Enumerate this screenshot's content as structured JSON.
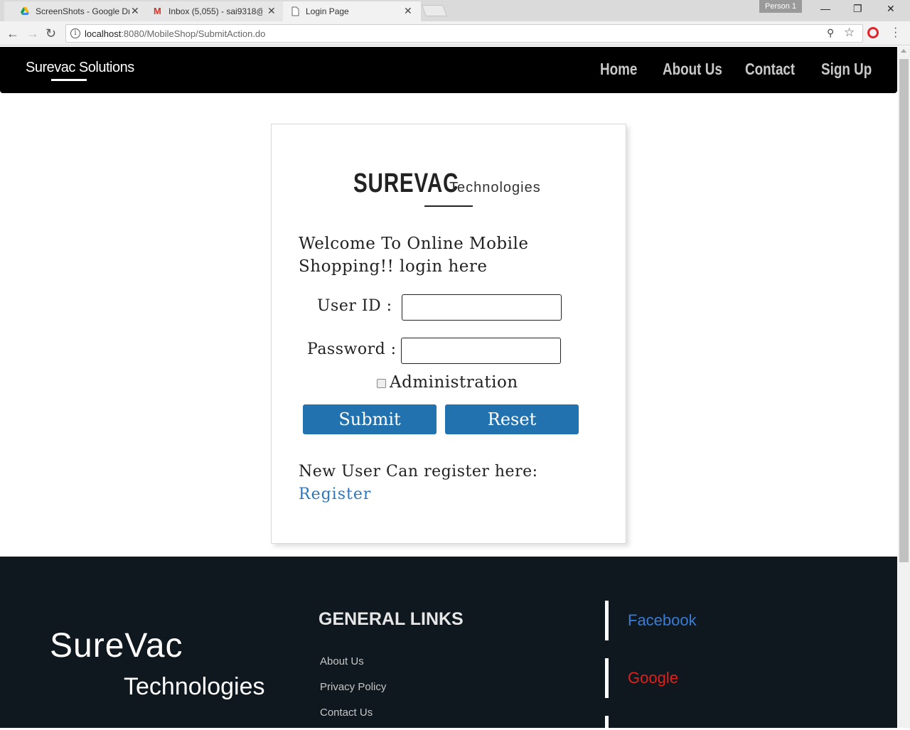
{
  "browser": {
    "tabs": [
      {
        "title": "ScreenShots - Google Dr",
        "icon": "google-drive-icon"
      },
      {
        "title": "Inbox (5,055) - sai9318@",
        "icon": "gmail-icon"
      },
      {
        "title": "Login Page",
        "icon": "page-icon"
      }
    ],
    "profile": "Person 1",
    "url_host": "localhost",
    "url_rest": ":8080/MobileShop/SubmitAction.do"
  },
  "header": {
    "brand": "Surevac Solutions",
    "nav": [
      "Home",
      "About Us",
      "Contact",
      "Sign Up"
    ]
  },
  "login": {
    "logo_big": "SUREVAC",
    "logo_small": "Technologies",
    "welcome": "Welcome To Online Mobile Shopping!! login here",
    "userid_label": "User ID :",
    "password_label": "Password :",
    "userid_value": "",
    "password_value": "",
    "admin_label": "Administration",
    "admin_checked": false,
    "submit": "Submit",
    "reset": "Reset",
    "new_user": "New User Can register here:",
    "register": "Register"
  },
  "footer": {
    "logo_top": "SureVac",
    "logo_bottom": "Technologies",
    "links_heading": "GENERAL LINKS",
    "links": [
      "About Us",
      "Privacy Policy",
      "Contact Us"
    ],
    "social": [
      {
        "label": "Facebook",
        "color": "#3a7bd5"
      },
      {
        "label": "Google",
        "color": "#e0201a"
      }
    ]
  },
  "colors": {
    "button": "#2372b0",
    "link": "#2a76c2",
    "footer_bg": "#0f181e"
  }
}
